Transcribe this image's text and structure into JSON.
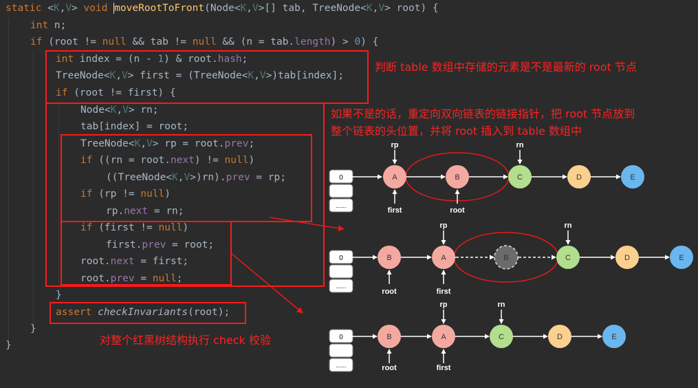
{
  "code": {
    "l1": {
      "a": "static ",
      "b": "<",
      "c": "K",
      "d": ",",
      "e": "V",
      "f": "> ",
      "g": "void ",
      "h": "moveRootToFront",
      "i": "(Node<",
      "j": "K",
      "k": ",",
      "l": "V",
      "m": ">[] tab, TreeNode<",
      "n": "K",
      "o": ",",
      "p": "V",
      "q": "> root) {"
    },
    "l2": {
      "a": "int ",
      "b": "n;"
    },
    "l3": {
      "a": "if ",
      "b": "(root != ",
      "c": "null ",
      "d": "&& tab != ",
      "e": "null ",
      "f": "&& (n = tab.",
      "g": "length",
      "h": ") > ",
      "i": "0",
      "j": ") {"
    },
    "l4": {
      "a": "int ",
      "b": "index = (n - ",
      "c": "1",
      "d": ") & root.",
      "e": "hash",
      "f": ";"
    },
    "l5": {
      "a": "TreeNode<",
      "b": "K",
      "c": ",",
      "d": "V",
      "e": "> first = (TreeNode<",
      "f": "K",
      "g": ",",
      "h": "V",
      "i": ">)tab[index];"
    },
    "l6": {
      "a": "if ",
      "b": "(root != first) {"
    },
    "l7": {
      "a": "Node<",
      "b": "K",
      "c": ",",
      "d": "V",
      "e": "> rn;"
    },
    "l8": {
      "a": "tab[index] = root;"
    },
    "l9": {
      "a": "TreeNode<",
      "b": "K",
      "c": ",",
      "d": "V",
      "e": "> rp = root.",
      "f": "prev",
      "g": ";"
    },
    "l10": {
      "a": "if ",
      "b": "((rn = root.",
      "c": "next",
      "d": ") != ",
      "e": "null",
      "f": ")"
    },
    "l11": {
      "a": "((TreeNode<",
      "b": "K",
      "c": ",",
      "d": "V",
      "e": ">)rn).",
      "f": "prev ",
      "g": "= rp;"
    },
    "l12": {
      "a": "if ",
      "b": "(rp != ",
      "c": "null",
      "d": ")"
    },
    "l13": {
      "a": "rp.",
      "b": "next ",
      "c": "= rn;"
    },
    "l14": {
      "a": "if ",
      "b": "(first != ",
      "c": "null",
      "d": ")"
    },
    "l15": {
      "a": "first.",
      "b": "prev ",
      "c": "= root;"
    },
    "l16": {
      "a": "root.",
      "b": "next ",
      "c": "= first;"
    },
    "l17": {
      "a": "root.",
      "b": "prev ",
      "c": "= ",
      "d": "null",
      "e": ";"
    },
    "l18": {
      "a": "}"
    },
    "l19": {
      "a": "assert ",
      "b": "checkInvariants",
      "c": "(root);"
    },
    "l20": {
      "a": "}"
    },
    "l21": {
      "a": "}"
    }
  },
  "annotations": {
    "judge": "判断 table 数组中存储的元素是不是最新的 root 节点",
    "relink1": "如果不是的话，重定向双向链表的链接指针，把 root 节点放到",
    "relink2": "整个链表的头位置，并将 root 插入到 table 数组中",
    "check": "对整个红黑树结构执行 check 校验"
  },
  "diagram": {
    "slots": [
      "0",
      "",
      "......"
    ],
    "d1": {
      "nodes": [
        "A",
        "B",
        "C",
        "D",
        "E"
      ],
      "labels": {
        "rp": "rp",
        "rn": "rn",
        "first": "first",
        "root": "root"
      }
    },
    "d2": {
      "nodes": [
        "B",
        "A",
        "B",
        "C",
        "D",
        "E"
      ],
      "labels": {
        "rp": "rp",
        "rn": "rn",
        "first": "first",
        "root": "root"
      }
    },
    "d3": {
      "nodes": [
        "B",
        "A",
        "C",
        "D",
        "E"
      ],
      "labels": {
        "rp": "rp",
        "rn": "rn",
        "first": "first",
        "root": "root"
      }
    }
  },
  "colors": {
    "red": "#f4a9a0",
    "green": "#b2de8e",
    "orange": "#fbd08e",
    "blue": "#6ab7ef",
    "gray": "#6b6b6b",
    "annotation": "#ff2222"
  }
}
